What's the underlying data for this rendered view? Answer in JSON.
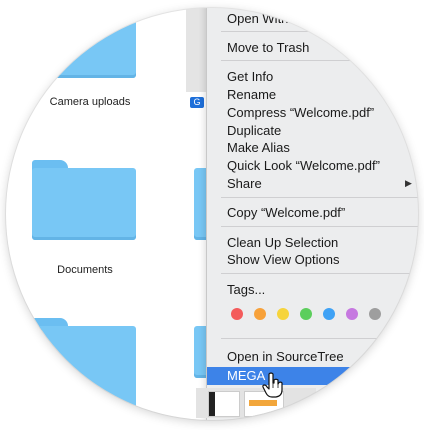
{
  "finder": {
    "items": [
      {
        "label": "Camera uploads"
      },
      {
        "label": "Documents"
      },
      {
        "label": ""
      }
    ],
    "partial_tag": "G"
  },
  "context_menu": {
    "items": [
      {
        "label": "Open With"
      },
      {
        "label": "Move to Trash"
      },
      {
        "label": "Get Info"
      },
      {
        "label": "Rename"
      },
      {
        "label": "Compress “Welcome.pdf”"
      },
      {
        "label": "Duplicate"
      },
      {
        "label": "Make Alias"
      },
      {
        "label": "Quick Look “Welcome.pdf”"
      },
      {
        "label": "Share"
      },
      {
        "label": "Copy “Welcome.pdf”"
      },
      {
        "label": "Clean Up Selection"
      },
      {
        "label": "Show View Options"
      },
      {
        "label": "Tags..."
      },
      {
        "label": "Open in SourceTree"
      },
      {
        "label": "MEGA"
      }
    ],
    "share_arrow": "▶",
    "tag_colors": [
      "#f45b5b",
      "#f7a13a",
      "#f6d43c",
      "#5cce5c",
      "#3fa2f5",
      "#c678e0",
      "#9e9e9e"
    ],
    "highlight_color": "#3d83e8"
  }
}
